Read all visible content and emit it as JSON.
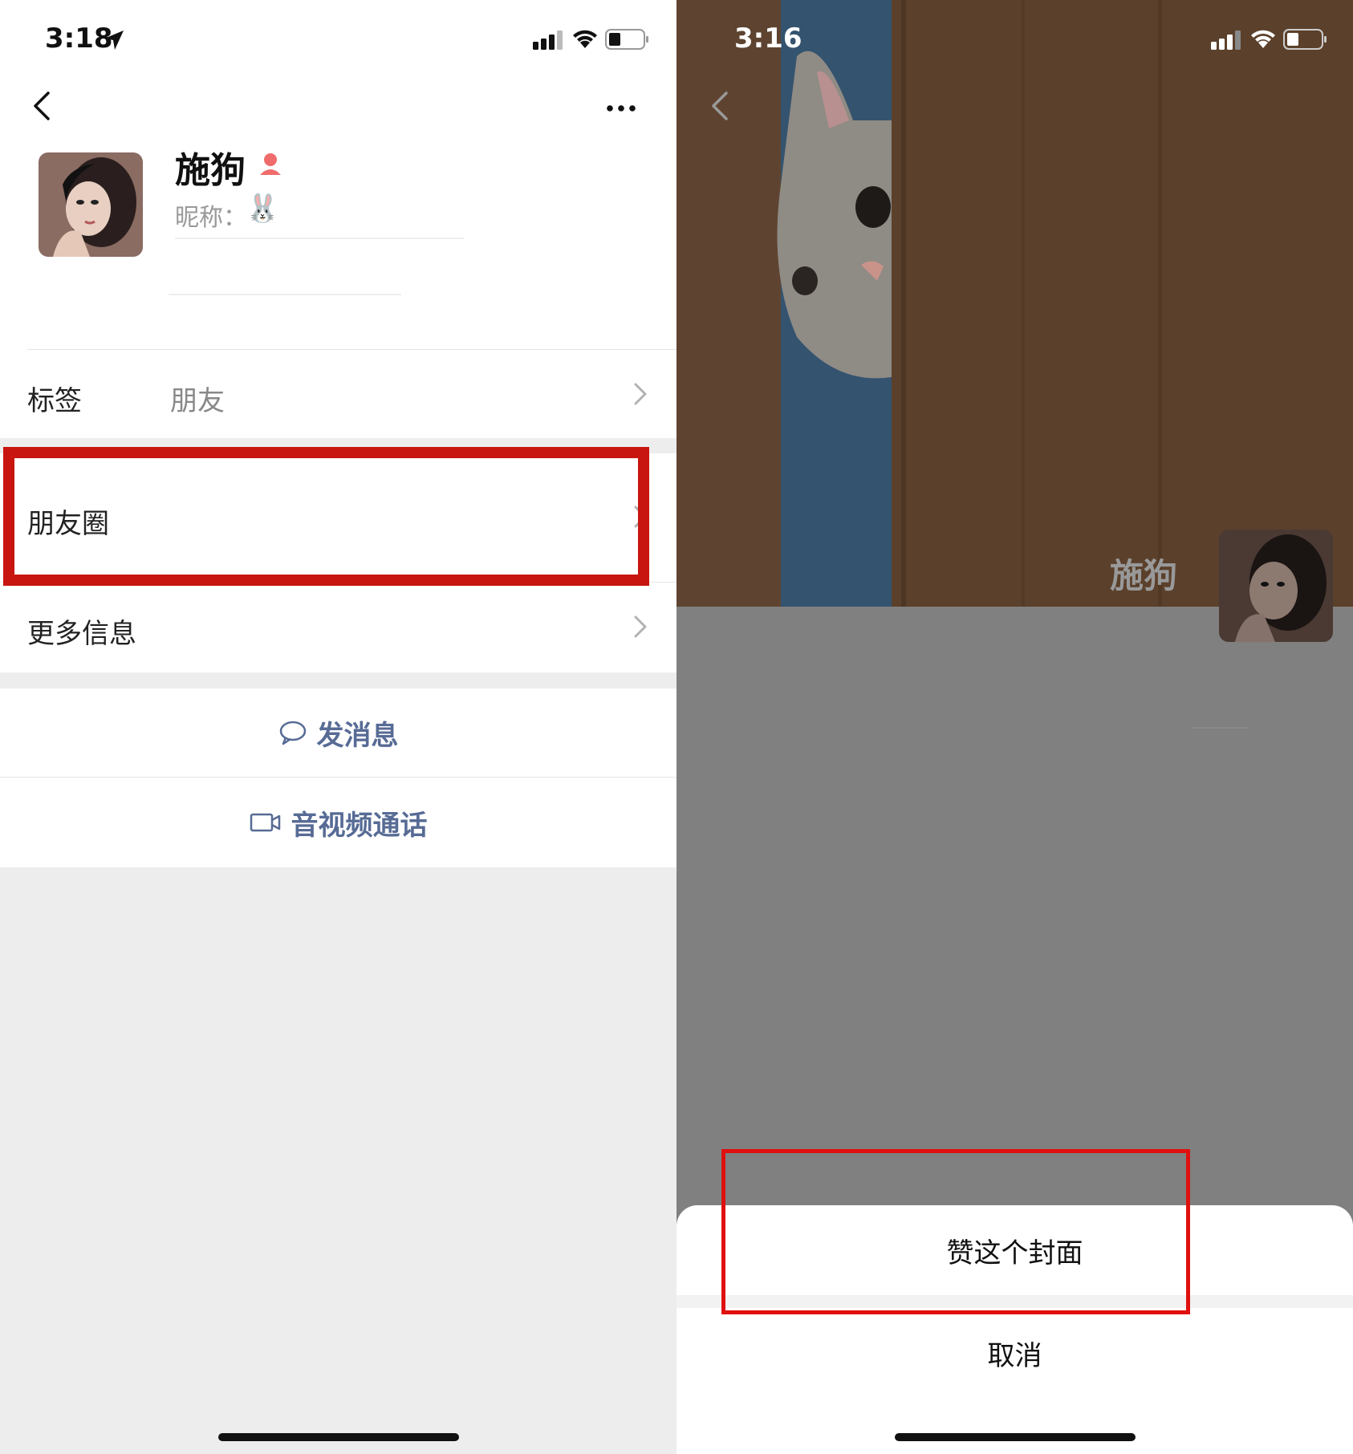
{
  "left": {
    "status": {
      "time": "3:18"
    },
    "profile": {
      "name": "施狗",
      "nickname_label": "昵称：",
      "nickname_emoji": "🐰"
    },
    "rows": {
      "tags_label": "标签",
      "tags_value": "朋友",
      "moments_label": "朋友圈",
      "more_info_label": "更多信息"
    },
    "actions": {
      "message_label": "发消息",
      "video_call_label": "音视频通话"
    }
  },
  "right": {
    "status": {
      "time": "3:16"
    },
    "profile": {
      "name": "施狗"
    },
    "sheet": {
      "like_cover_label": "赞这个封面",
      "cancel_label": "取消"
    }
  },
  "colors": {
    "link_blue": "#576b95",
    "highlight_red_left": "#c8150f",
    "highlight_red_right": "#e01010",
    "overlay_gray": "#808080",
    "page_bg": "#ededed"
  }
}
